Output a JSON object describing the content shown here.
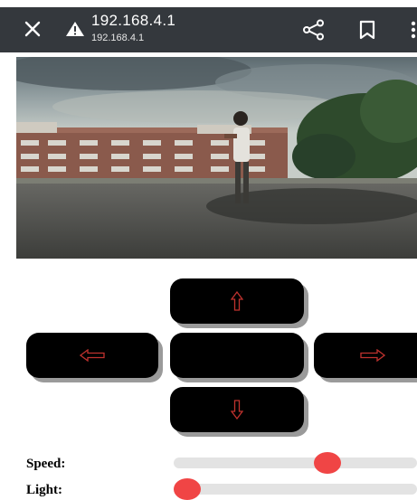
{
  "browser": {
    "url_main": "192.168.4.1",
    "url_sub": "192.168.4.1",
    "icons": [
      "close-icon",
      "warning-icon",
      "share-icon",
      "bookmark-icon",
      "more-icon"
    ]
  },
  "stream": {
    "icon": "camera-stream-image"
  },
  "controls": {
    "up_icon": "arrow-up-icon",
    "left_icon": "arrow-left-icon",
    "right_icon": "arrow-right-icon",
    "down_icon": "arrow-down-icon",
    "arrow_color": "#c0322e",
    "button_color": "#000000"
  },
  "sliders": {
    "speed_label": "Speed:",
    "speed_value": 0.65,
    "light_label": "Light:",
    "light_value": 0.0,
    "thumb_color": "#f04545"
  }
}
